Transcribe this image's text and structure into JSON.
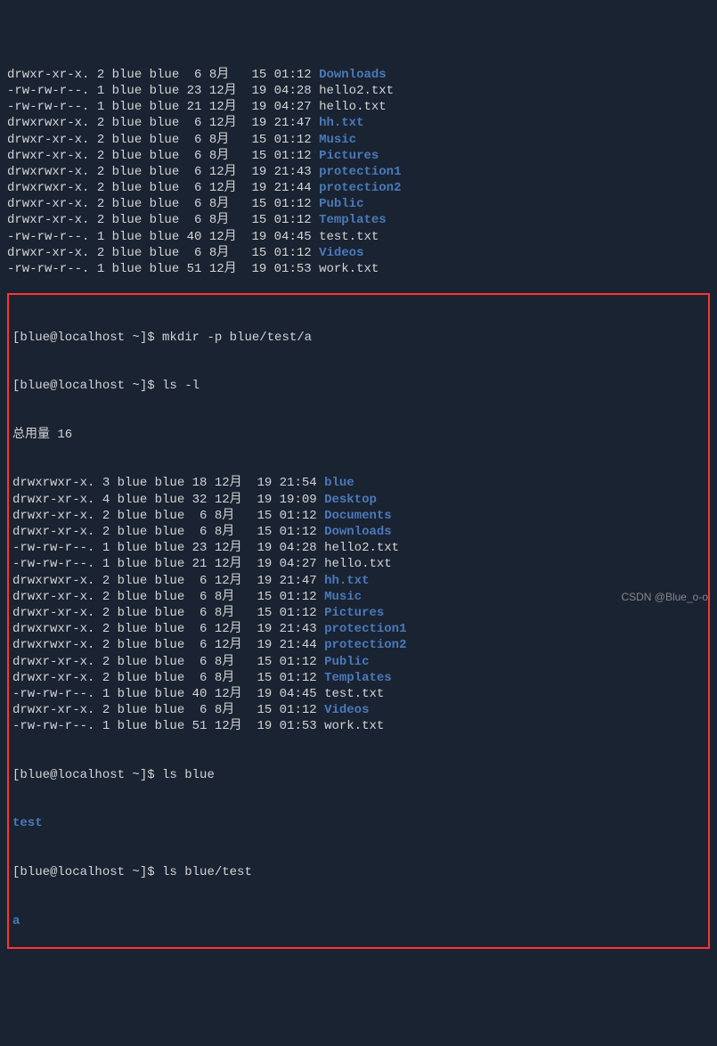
{
  "top_listing": [
    {
      "perm": "drwxr-xr-x.",
      "links": "2",
      "owner": "blue",
      "group": "blue",
      "size": " 6",
      "month": "8月 ",
      "day": "15",
      "time": "01:12",
      "name": "Downloads",
      "dir": true
    },
    {
      "perm": "-rw-rw-r--.",
      "links": "1",
      "owner": "blue",
      "group": "blue",
      "size": "23",
      "month": "12月",
      "day": "19",
      "time": "04:28",
      "name": "hello2.txt",
      "dir": false
    },
    {
      "perm": "-rw-rw-r--.",
      "links": "1",
      "owner": "blue",
      "group": "blue",
      "size": "21",
      "month": "12月",
      "day": "19",
      "time": "04:27",
      "name": "hello.txt",
      "dir": false
    },
    {
      "perm": "drwxrwxr-x.",
      "links": "2",
      "owner": "blue",
      "group": "blue",
      "size": " 6",
      "month": "12月",
      "day": "19",
      "time": "21:47",
      "name": "hh.txt",
      "dir": true
    },
    {
      "perm": "drwxr-xr-x.",
      "links": "2",
      "owner": "blue",
      "group": "blue",
      "size": " 6",
      "month": "8月 ",
      "day": "15",
      "time": "01:12",
      "name": "Music",
      "dir": true
    },
    {
      "perm": "drwxr-xr-x.",
      "links": "2",
      "owner": "blue",
      "group": "blue",
      "size": " 6",
      "month": "8月 ",
      "day": "15",
      "time": "01:12",
      "name": "Pictures",
      "dir": true
    },
    {
      "perm": "drwxrwxr-x.",
      "links": "2",
      "owner": "blue",
      "group": "blue",
      "size": " 6",
      "month": "12月",
      "day": "19",
      "time": "21:43",
      "name": "protection1",
      "dir": true
    },
    {
      "perm": "drwxrwxr-x.",
      "links": "2",
      "owner": "blue",
      "group": "blue",
      "size": " 6",
      "month": "12月",
      "day": "19",
      "time": "21:44",
      "name": "protection2",
      "dir": true
    },
    {
      "perm": "drwxr-xr-x.",
      "links": "2",
      "owner": "blue",
      "group": "blue",
      "size": " 6",
      "month": "8月 ",
      "day": "15",
      "time": "01:12",
      "name": "Public",
      "dir": true
    },
    {
      "perm": "drwxr-xr-x.",
      "links": "2",
      "owner": "blue",
      "group": "blue",
      "size": " 6",
      "month": "8月 ",
      "day": "15",
      "time": "01:12",
      "name": "Templates",
      "dir": true
    },
    {
      "perm": "-rw-rw-r--.",
      "links": "1",
      "owner": "blue",
      "group": "blue",
      "size": "40",
      "month": "12月",
      "day": "19",
      "time": "04:45",
      "name": "test.txt",
      "dir": false
    },
    {
      "perm": "drwxr-xr-x.",
      "links": "2",
      "owner": "blue",
      "group": "blue",
      "size": " 6",
      "month": "8月 ",
      "day": "15",
      "time": "01:12",
      "name": "Videos",
      "dir": true
    },
    {
      "perm": "-rw-rw-r--.",
      "links": "1",
      "owner": "blue",
      "group": "blue",
      "size": "51",
      "month": "12月",
      "day": "19",
      "time": "01:53",
      "name": "work.txt",
      "dir": false
    }
  ],
  "box": {
    "cmd1_prompt": "[blue@localhost ~]$ ",
    "cmd1": "mkdir -p blue/test/a",
    "cmd2_prompt": "[blue@localhost ~]$ ",
    "cmd2": "ls -l",
    "total_label": "总用量 16",
    "listing": [
      {
        "perm": "drwxrwxr-x.",
        "links": "3",
        "owner": "blue",
        "group": "blue",
        "size": "18",
        "month": "12月",
        "day": "19",
        "time": "21:54",
        "name": "blue",
        "dir": true
      },
      {
        "perm": "drwxr-xr-x.",
        "links": "4",
        "owner": "blue",
        "group": "blue",
        "size": "32",
        "month": "12月",
        "day": "19",
        "time": "19:09",
        "name": "Desktop",
        "dir": true
      },
      {
        "perm": "drwxr-xr-x.",
        "links": "2",
        "owner": "blue",
        "group": "blue",
        "size": " 6",
        "month": "8月 ",
        "day": "15",
        "time": "01:12",
        "name": "Documents",
        "dir": true
      },
      {
        "perm": "drwxr-xr-x.",
        "links": "2",
        "owner": "blue",
        "group": "blue",
        "size": " 6",
        "month": "8月 ",
        "day": "15",
        "time": "01:12",
        "name": "Downloads",
        "dir": true
      },
      {
        "perm": "-rw-rw-r--.",
        "links": "1",
        "owner": "blue",
        "group": "blue",
        "size": "23",
        "month": "12月",
        "day": "19",
        "time": "04:28",
        "name": "hello2.txt",
        "dir": false
      },
      {
        "perm": "-rw-rw-r--.",
        "links": "1",
        "owner": "blue",
        "group": "blue",
        "size": "21",
        "month": "12月",
        "day": "19",
        "time": "04:27",
        "name": "hello.txt",
        "dir": false
      },
      {
        "perm": "drwxrwxr-x.",
        "links": "2",
        "owner": "blue",
        "group": "blue",
        "size": " 6",
        "month": "12月",
        "day": "19",
        "time": "21:47",
        "name": "hh.txt",
        "dir": true
      },
      {
        "perm": "drwxr-xr-x.",
        "links": "2",
        "owner": "blue",
        "group": "blue",
        "size": " 6",
        "month": "8月 ",
        "day": "15",
        "time": "01:12",
        "name": "Music",
        "dir": true
      },
      {
        "perm": "drwxr-xr-x.",
        "links": "2",
        "owner": "blue",
        "group": "blue",
        "size": " 6",
        "month": "8月 ",
        "day": "15",
        "time": "01:12",
        "name": "Pictures",
        "dir": true
      },
      {
        "perm": "drwxrwxr-x.",
        "links": "2",
        "owner": "blue",
        "group": "blue",
        "size": " 6",
        "month": "12月",
        "day": "19",
        "time": "21:43",
        "name": "protection1",
        "dir": true
      },
      {
        "perm": "drwxrwxr-x.",
        "links": "2",
        "owner": "blue",
        "group": "blue",
        "size": " 6",
        "month": "12月",
        "day": "19",
        "time": "21:44",
        "name": "protection2",
        "dir": true
      },
      {
        "perm": "drwxr-xr-x.",
        "links": "2",
        "owner": "blue",
        "group": "blue",
        "size": " 6",
        "month": "8月 ",
        "day": "15",
        "time": "01:12",
        "name": "Public",
        "dir": true
      },
      {
        "perm": "drwxr-xr-x.",
        "links": "2",
        "owner": "blue",
        "group": "blue",
        "size": " 6",
        "month": "8月 ",
        "day": "15",
        "time": "01:12",
        "name": "Templates",
        "dir": true
      },
      {
        "perm": "-rw-rw-r--.",
        "links": "1",
        "owner": "blue",
        "group": "blue",
        "size": "40",
        "month": "12月",
        "day": "19",
        "time": "04:45",
        "name": "test.txt",
        "dir": false
      },
      {
        "perm": "drwxr-xr-x.",
        "links": "2",
        "owner": "blue",
        "group": "blue",
        "size": " 6",
        "month": "8月 ",
        "day": "15",
        "time": "01:12",
        "name": "Videos",
        "dir": true
      },
      {
        "perm": "-rw-rw-r--.",
        "links": "1",
        "owner": "blue",
        "group": "blue",
        "size": "51",
        "month": "12月",
        "day": "19",
        "time": "01:53",
        "name": "work.txt",
        "dir": false
      }
    ],
    "cmd3_prompt": "[blue@localhost ~]$ ",
    "cmd3": "ls blue",
    "cmd3_out": "test",
    "cmd4_prompt": "[blue@localhost ~]$ ",
    "cmd4": "ls blue/test",
    "cmd4_out": "a"
  },
  "watermark": "CSDN @Blue_o-o"
}
